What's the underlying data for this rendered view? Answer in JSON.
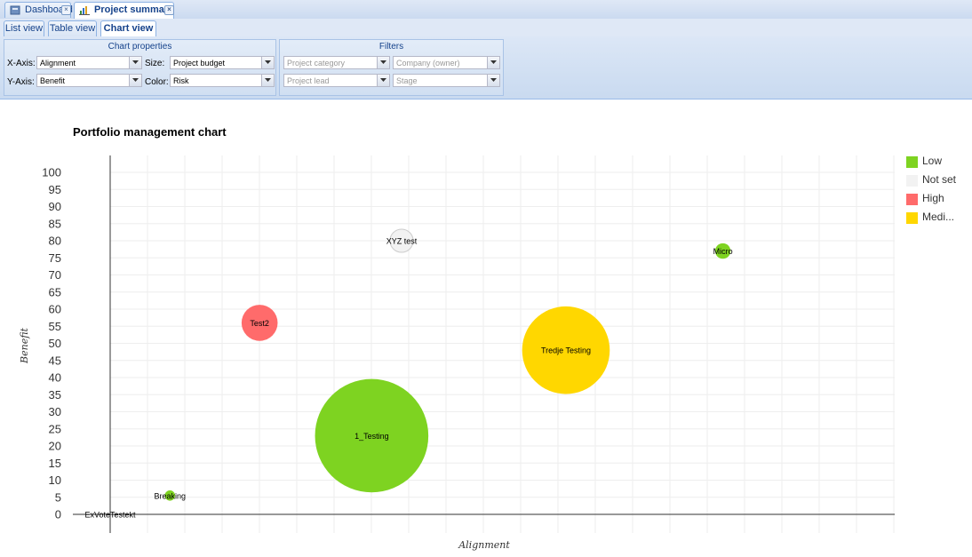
{
  "tabs": [
    {
      "label": "Dashboard",
      "icon": "dashboard-icon",
      "active": false
    },
    {
      "label": "Project summary",
      "icon": "chart-icon",
      "active": true
    }
  ],
  "subtabs": [
    "List view",
    "Table view",
    "Chart view"
  ],
  "chart_properties": {
    "title": "Chart properties",
    "x_axis_label": "X-Axis:",
    "x_axis_value": "Alignment",
    "y_axis_label": "Y-Axis:",
    "y_axis_value": "Benefit",
    "size_label": "Size:",
    "size_value": "Project budget",
    "color_label": "Color:",
    "color_value": "Risk"
  },
  "filters": {
    "title": "Filters",
    "project_category": "Project category",
    "company_owner": "Company (owner)",
    "project_lead": "Project lead",
    "stage": "Stage"
  },
  "chart_data": {
    "type": "bubble",
    "title": "Portfolio management chart",
    "xlabel": "Alignment",
    "ylabel": "Benefit",
    "yticks": [
      0,
      5,
      10,
      15,
      20,
      25,
      30,
      35,
      40,
      45,
      50,
      55,
      60,
      65,
      70,
      75,
      80,
      85,
      90,
      95,
      100
    ],
    "ylim": [
      0,
      105
    ],
    "xlim": [
      0,
      105
    ],
    "legend": [
      {
        "name": "Low",
        "color": "#7ed321"
      },
      {
        "name": "Not set",
        "color": "#f2f2f2"
      },
      {
        "name": "High",
        "color": "#ff6b6b"
      },
      {
        "name": "Medi...",
        "color": "#ffd700"
      }
    ],
    "points": [
      {
        "name": "ExVoteTestekt",
        "x": 0,
        "y": 0,
        "size": 0,
        "risk": "Not set"
      },
      {
        "name": "Breaking",
        "x": 8,
        "y": 5.5,
        "size": 2,
        "risk": "Low"
      },
      {
        "name": "Test2",
        "x": 20,
        "y": 56,
        "size": 7,
        "risk": "High"
      },
      {
        "name": "1_Testing",
        "x": 35,
        "y": 23,
        "size": 22,
        "risk": "Low"
      },
      {
        "name": "XYZ test",
        "x": 39,
        "y": 80,
        "size": 4.5,
        "risk": "Not set"
      },
      {
        "name": "Tredje Testing",
        "x": 61,
        "y": 48,
        "size": 17,
        "risk": "Medi..."
      },
      {
        "name": "Micro",
        "x": 82,
        "y": 77,
        "size": 3,
        "risk": "Low"
      }
    ]
  }
}
